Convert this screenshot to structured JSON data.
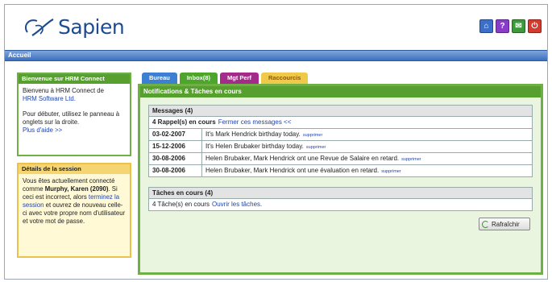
{
  "brand": {
    "name": "Sapien"
  },
  "top_icons": [
    {
      "name": "home-icon",
      "color": "#3b6fc9",
      "glyph": "⌂"
    },
    {
      "name": "help-icon",
      "color": "#8b3bc9",
      "glyph": "?"
    },
    {
      "name": "mail-icon",
      "color": "#3c9a3a",
      "glyph": "✉"
    },
    {
      "name": "power-icon",
      "color": "#d23b2e",
      "glyph": "⏻"
    }
  ],
  "nav": {
    "breadcrumb": "Accueil"
  },
  "welcome": {
    "title": "Bienvenue sur HRM Connect",
    "line1": "Bienvenu à HRM Connect de",
    "company_link": "HRM Software Ltd.",
    "line2": "Pour débuter, utilisez le panneau à onglets sur la droite.",
    "help_link": "Plus d'aide >>"
  },
  "session": {
    "title": "Détails de la session",
    "text1": "Vous êtes actuellement connecté comme",
    "user": "Murphy, Karen (2090)",
    "text2": ". Si ceci est incorrect, alors",
    "terminate_link": "terminez la session",
    "text3": "et ouvrez de nouveau celle-ci avec votre propre nom d'utilisateur et votre mot de passe."
  },
  "tabs": [
    {
      "label": "Bureau",
      "color": "#3d7fd0"
    },
    {
      "label": "Inbox(8)",
      "color": "#4da52c"
    },
    {
      "label": "Mgt Perf",
      "color": "#a52b8a"
    },
    {
      "label": "Raccourcis",
      "color": "#f0c84a"
    }
  ],
  "panel": {
    "title": "Notifications & Tâches en cours",
    "messages": {
      "header": "Messages (4)",
      "reminders_text": "4 Rappel(s) en cours",
      "reminders_link": "Fermer ces messages <<",
      "delete_label": "supprimer",
      "rows": [
        {
          "date": "03-02-2007",
          "text": "It's Mark Hendrick birthday today."
        },
        {
          "date": "15-12-2006",
          "text": "It's Helen Brubaker birthday today."
        },
        {
          "date": "30-08-2006",
          "text": "Helen Brubaker, Mark Hendrick ont une Revue de Salaire en retard."
        },
        {
          "date": "30-08-2006",
          "text": "Helen Brubaker, Mark Hendrick ont une évaluation en retard."
        }
      ]
    },
    "tasks": {
      "header": "Tâches en cours (4)",
      "text": "4 Tâche(s) en cours",
      "link": "Ouvrir les tâches."
    },
    "refresh_label": "Rafraîchir"
  }
}
